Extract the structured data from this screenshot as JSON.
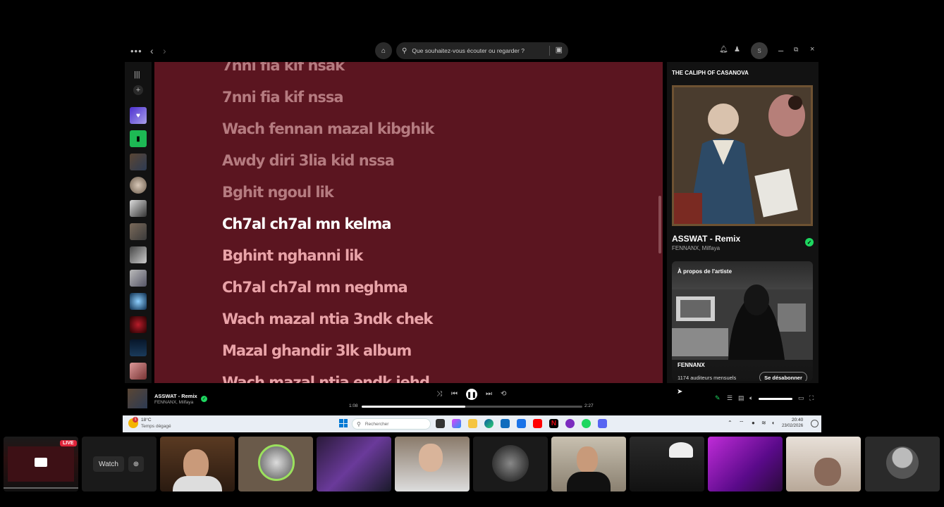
{
  "window": {
    "search_placeholder": "Que souhaitez-vous écouter ou regarder ?",
    "avatar_initial": "S"
  },
  "lyrics": [
    {
      "text": "7nni fia kif nsak",
      "state": "faded"
    },
    {
      "text": "7nni fia kif nssa",
      "state": "faded"
    },
    {
      "text": "Wach fennan mazal kibghik",
      "state": "faded"
    },
    {
      "text": "Awdy diri 3lia kid nssa",
      "state": "faded"
    },
    {
      "text": "Bghit ngoul lik",
      "state": "faded"
    },
    {
      "text": "Ch7al ch7al mn kelma",
      "state": "active"
    },
    {
      "text": "Bghint nghanni lik",
      "state": "upcoming"
    },
    {
      "text": "Ch7al ch7al mn neghma",
      "state": "upcoming"
    },
    {
      "text": "Wach mazal ntia 3ndk chek",
      "state": "upcoming"
    },
    {
      "text": "Mazal ghandir 3lk album",
      "state": "upcoming"
    },
    {
      "text": "Wach mazal ntia endk iehd",
      "state": "upcoming"
    }
  ],
  "now_playing_panel": {
    "playlist_title": "THE CALIPH OF CASANOVA",
    "track_name": "ASSWAT - Remix",
    "artists": "FENNANX, Milfaya",
    "about_title": "À propos de l'artiste",
    "about_artist": "FENNANX",
    "about_listeners": "1174 auditeurs mensuels",
    "unsubscribe_label": "Se désabonner"
  },
  "player": {
    "track_name": "ASSWAT - Remix",
    "artists": "FENNANX, Milfaya",
    "time_current": "1:08",
    "time_total": "2:27",
    "progress": 0.47,
    "volume": 1.0
  },
  "taskbar": {
    "weather_temp": "18°C",
    "weather_desc": "Temps dégagé",
    "search_placeholder": "Rechercher",
    "time": "20:40",
    "date": "23/02/2026",
    "notification_count": "1"
  },
  "call": {
    "live_badge": "LIVE",
    "watch_label": "Watch"
  },
  "colors": {
    "lyrics_bg": "#5b1520",
    "accent_green": "#1ed760",
    "live_red": "#e0243a"
  }
}
